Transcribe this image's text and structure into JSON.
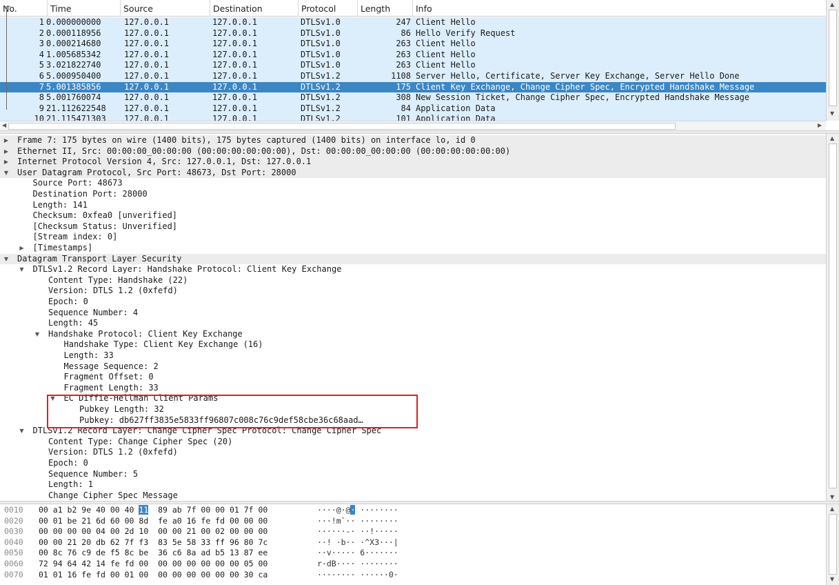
{
  "packet_list": {
    "columns": [
      "No.",
      "Time",
      "Source",
      "Destination",
      "Protocol",
      "Length",
      "Info"
    ],
    "rows": [
      {
        "no": "1",
        "time": "0.000000000",
        "src": "127.0.0.1",
        "dst": "127.0.0.1",
        "proto": "DTLSv1.0",
        "len": "247",
        "info": "Client Hello"
      },
      {
        "no": "2",
        "time": "0.000118956",
        "src": "127.0.0.1",
        "dst": "127.0.0.1",
        "proto": "DTLSv1.0",
        "len": "86",
        "info": "Hello Verify Request"
      },
      {
        "no": "3",
        "time": "0.000214680",
        "src": "127.0.0.1",
        "dst": "127.0.0.1",
        "proto": "DTLSv1.0",
        "len": "263",
        "info": "Client Hello"
      },
      {
        "no": "4",
        "time": "1.005685342",
        "src": "127.0.0.1",
        "dst": "127.0.0.1",
        "proto": "DTLSv1.0",
        "len": "263",
        "info": "Client Hello"
      },
      {
        "no": "5",
        "time": "3.021822740",
        "src": "127.0.0.1",
        "dst": "127.0.0.1",
        "proto": "DTLSv1.0",
        "len": "263",
        "info": "Client Hello"
      },
      {
        "no": "6",
        "time": "5.000950400",
        "src": "127.0.0.1",
        "dst": "127.0.0.1",
        "proto": "DTLSv1.2",
        "len": "1108",
        "info": "Server Hello, Certificate, Server Key Exchange, Server Hello Done"
      },
      {
        "no": "7",
        "time": "5.001385856",
        "src": "127.0.0.1",
        "dst": "127.0.0.1",
        "proto": "DTLSv1.2",
        "len": "175",
        "info": "Client Key Exchange, Change Cipher Spec, Encrypted Handshake Message",
        "selected": true
      },
      {
        "no": "8",
        "time": "5.001760074",
        "src": "127.0.0.1",
        "dst": "127.0.0.1",
        "proto": "DTLSv1.2",
        "len": "308",
        "info": "New Session Ticket, Change Cipher Spec, Encrypted Handshake Message"
      },
      {
        "no": "9",
        "time": "21.112622548",
        "src": "127.0.0.1",
        "dst": "127.0.0.1",
        "proto": "DTLSv1.2",
        "len": "84",
        "info": "Application Data"
      },
      {
        "no": "10",
        "time": "21.115471303",
        "src": "127.0.0.1",
        "dst": "127.0.0.1",
        "proto": "DTLSv1.2",
        "len": "101",
        "info": "Application Data"
      }
    ]
  },
  "details": {
    "lines": [
      {
        "indent": 0,
        "toggle": "collapsed",
        "group": true,
        "text": "Frame 7: 175 bytes on wire (1400 bits), 175 bytes captured (1400 bits) on interface lo, id 0"
      },
      {
        "indent": 0,
        "toggle": "collapsed",
        "group": true,
        "text": "Ethernet II, Src: 00:00:00_00:00:00 (00:00:00:00:00:00), Dst: 00:00:00_00:00:00 (00:00:00:00:00:00)"
      },
      {
        "indent": 0,
        "toggle": "collapsed",
        "group": true,
        "text": "Internet Protocol Version 4, Src: 127.0.0.1, Dst: 127.0.0.1"
      },
      {
        "indent": 0,
        "toggle": "expanded",
        "group": true,
        "text": "User Datagram Protocol, Src Port: 48673, Dst Port: 28000"
      },
      {
        "indent": 1,
        "toggle": "none",
        "text": "Source Port: 48673"
      },
      {
        "indent": 1,
        "toggle": "none",
        "text": "Destination Port: 28000"
      },
      {
        "indent": 1,
        "toggle": "none",
        "text": "Length: 141"
      },
      {
        "indent": 1,
        "toggle": "none",
        "text": "Checksum: 0xfea0 [unverified]"
      },
      {
        "indent": 1,
        "toggle": "none",
        "text": "[Checksum Status: Unverified]"
      },
      {
        "indent": 1,
        "toggle": "none",
        "text": "[Stream index: 0]"
      },
      {
        "indent": 1,
        "toggle": "collapsed",
        "text": "[Timestamps]"
      },
      {
        "indent": 0,
        "toggle": "expanded",
        "group": true,
        "text": "Datagram Transport Layer Security"
      },
      {
        "indent": 1,
        "toggle": "expanded",
        "text": "DTLSv1.2 Record Layer: Handshake Protocol: Client Key Exchange"
      },
      {
        "indent": 2,
        "toggle": "none",
        "text": "Content Type: Handshake (22)"
      },
      {
        "indent": 2,
        "toggle": "none",
        "text": "Version: DTLS 1.2 (0xfefd)"
      },
      {
        "indent": 2,
        "toggle": "none",
        "text": "Epoch: 0"
      },
      {
        "indent": 2,
        "toggle": "none",
        "text": "Sequence Number: 4"
      },
      {
        "indent": 2,
        "toggle": "none",
        "text": "Length: 45"
      },
      {
        "indent": 2,
        "toggle": "expanded",
        "text": "Handshake Protocol: Client Key Exchange"
      },
      {
        "indent": 3,
        "toggle": "none",
        "text": "Handshake Type: Client Key Exchange (16)"
      },
      {
        "indent": 3,
        "toggle": "none",
        "text": "Length: 33"
      },
      {
        "indent": 3,
        "toggle": "none",
        "text": "Message Sequence: 2"
      },
      {
        "indent": 3,
        "toggle": "none",
        "text": "Fragment Offset: 0"
      },
      {
        "indent": 3,
        "toggle": "none",
        "text": "Fragment Length: 33"
      },
      {
        "indent": 3,
        "toggle": "expanded",
        "text": "EC Diffie-Hellman Client Params"
      },
      {
        "indent": 4,
        "toggle": "none",
        "text": "Pubkey Length: 32"
      },
      {
        "indent": 4,
        "toggle": "none",
        "text": "Pubkey: db627ff3835e5833ff96807c008c76c9def58cbe36c68aad…"
      },
      {
        "indent": 1,
        "toggle": "expanded",
        "text": "DTLSv1.2 Record Layer: Change Cipher Spec Protocol: Change Cipher Spec"
      },
      {
        "indent": 2,
        "toggle": "none",
        "text": "Content Type: Change Cipher Spec (20)"
      },
      {
        "indent": 2,
        "toggle": "none",
        "text": "Version: DTLS 1.2 (0xfefd)"
      },
      {
        "indent": 2,
        "toggle": "none",
        "text": "Epoch: 0"
      },
      {
        "indent": 2,
        "toggle": "none",
        "text": "Sequence Number: 5"
      },
      {
        "indent": 2,
        "toggle": "none",
        "text": "Length: 1"
      },
      {
        "indent": 2,
        "toggle": "none",
        "text": "Change Cipher Spec Message"
      }
    ]
  },
  "bytes": {
    "rows": [
      {
        "offset": "0010",
        "hex_pre": "00 a1 b2 9e 40 00 40 ",
        "hex_hl": "11",
        "hex_post": "  89 ab 7f 00 00 01 7f 00",
        "ascii_pre": "····@·@",
        "ascii_hl": "·",
        "ascii_post": " ········"
      },
      {
        "offset": "0020",
        "hex_pre": "00 01 be 21 6d 60 00 8d  fe a0 16 fe fd 00 00 00",
        "hex_hl": "",
        "hex_post": "",
        "ascii_pre": "···!m`·· ········",
        "ascii_hl": "",
        "ascii_post": ""
      },
      {
        "offset": "0030",
        "hex_pre": "00 00 00 00 04 00 2d 10  00 00 21 00 02 00 00 00",
        "hex_hl": "",
        "hex_post": "",
        "ascii_pre": "······-· ··!·····",
        "ascii_hl": "",
        "ascii_post": ""
      },
      {
        "offset": "0040",
        "hex_pre": "00 00 21 20 db 62 7f f3  83 5e 58 33 ff 96 80 7c",
        "hex_hl": "",
        "hex_post": "",
        "ascii_pre": "··! ·b·· ·^X3···|",
        "ascii_hl": "",
        "ascii_post": ""
      },
      {
        "offset": "0050",
        "hex_pre": "00 8c 76 c9 de f5 8c be  36 c6 8a ad b5 13 87 ee",
        "hex_hl": "",
        "hex_post": "",
        "ascii_pre": "··v····· 6·······",
        "ascii_hl": "",
        "ascii_post": ""
      },
      {
        "offset": "0060",
        "hex_pre": "72 94 64 42 14 fe fd 00  00 00 00 00 00 00 05 00",
        "hex_hl": "",
        "hex_post": "",
        "ascii_pre": "r·dB···· ········",
        "ascii_hl": "",
        "ascii_post": ""
      },
      {
        "offset": "0070",
        "hex_pre": "01 01 16 fe fd 00 01 00  00 00 00 00 00 00 30 ca",
        "hex_hl": "",
        "hex_post": "",
        "ascii_pre": "········ ······0·",
        "ascii_hl": "",
        "ascii_post": ""
      }
    ]
  },
  "icons": {
    "collapsed": "▶",
    "expanded": "▼"
  },
  "colors": {
    "row_bg": "#dceefb",
    "selected_bg": "#3b86c4",
    "group_bg": "#ececec",
    "highlight_border": "#e0201e"
  }
}
